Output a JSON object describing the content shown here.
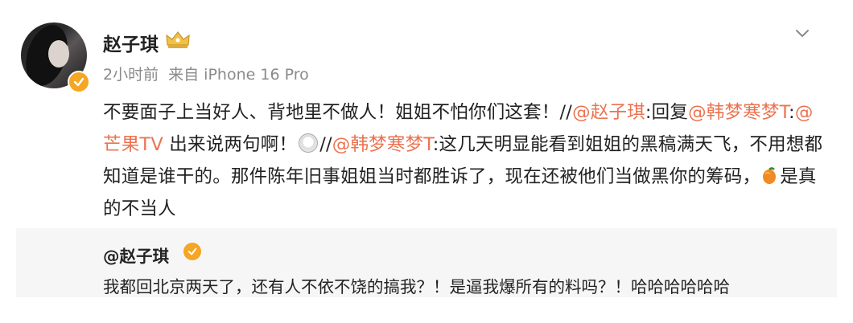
{
  "post": {
    "username": "赵子琪",
    "time": "2小时前",
    "source": "来自 iPhone 16 Pro",
    "content": {
      "t1": "不要面子上当好人、背地里不做人！姐姐不怕你们这套！//",
      "m1": "@赵子琪",
      "t2": ":回复",
      "m2": "@韩梦寒梦T",
      "t3": ":",
      "m3": "@芒果TV",
      "t4": " 出来说两句啊！",
      "t5": "//",
      "m4": "@韩梦寒梦T",
      "t6": ":这几天明显能看到姐姐的黑稿满天飞，不用想都知道是谁干的。那件陈年旧事姐姐当时都胜诉了，现在还被他们当做黑你的筹码，",
      "t7": "是真的不当人"
    }
  },
  "repost": {
    "username": "@赵子琪",
    "text": "我都回北京两天了，还有人不依不饶的搞我？！是逼我爆所有的料吗？！哈哈哈哈哈哈"
  },
  "colors": {
    "link": "#eb7350",
    "verified": "#f5a623",
    "meta": "#8a8a8a",
    "repost_bg": "#f6f6f6"
  },
  "icons": [
    "avatar",
    "verified-badge-icon",
    "crown-icon",
    "chevron-down-icon",
    "smile-emoji-icon",
    "mango-emoji-icon"
  ]
}
